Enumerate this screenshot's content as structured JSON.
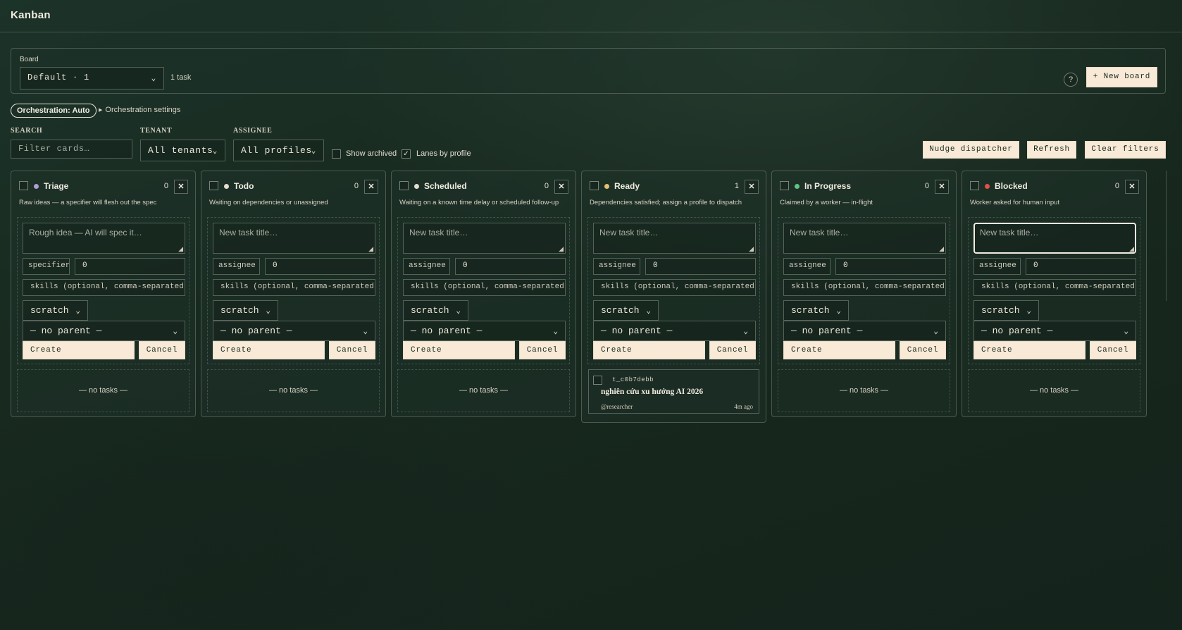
{
  "app": {
    "title": "Kanban"
  },
  "board": {
    "label": "Board",
    "selected": "Default · 1",
    "task_count": "1 task",
    "help": "?",
    "new_board": "+ New board"
  },
  "orchestration": {
    "pill": "Orchestration: Auto",
    "settings": "Orchestration settings"
  },
  "filters": {
    "search_label": "SEARCH",
    "search_placeholder": "Filter cards…",
    "tenant_label": "TENANT",
    "tenant_value": "All tenants",
    "assignee_label": "ASSIGNEE",
    "assignee_value": "All profiles",
    "show_archived": "Show archived",
    "show_archived_checked": false,
    "lanes_by_profile": "Lanes by profile",
    "lanes_by_profile_checked": true
  },
  "toolbar": {
    "nudge": "Nudge dispatcher",
    "refresh": "Refresh",
    "clear": "Clear filters"
  },
  "form_common": {
    "priority": "0",
    "skills_placeholder": "skills (optional, comma-separated)",
    "workspace": "scratch",
    "parent": "— no parent —",
    "create": "Create",
    "cancel": "Cancel",
    "close": "✕",
    "empty": "— no tasks —"
  },
  "columns": [
    {
      "name": "Triage",
      "count": "0",
      "color": "#b49ad8",
      "desc": "Raw ideas — a specifier will flesh out the spec",
      "title_placeholder": "Rough idea — AI will spec it…",
      "role_placeholder": "specifier"
    },
    {
      "name": "Todo",
      "count": "0",
      "color": "#e3ded0",
      "desc": "Waiting on dependencies or unassigned",
      "title_placeholder": "New task title…",
      "role_placeholder": "assignee"
    },
    {
      "name": "Scheduled",
      "count": "0",
      "color": "#e3ded0",
      "desc": "Waiting on a known time delay or scheduled follow-up",
      "title_placeholder": "New task title…",
      "role_placeholder": "assignee"
    },
    {
      "name": "Ready",
      "count": "1",
      "color": "#e6c06e",
      "desc": "Dependencies satisfied; assign a profile to dispatch",
      "title_placeholder": "New task title…",
      "role_placeholder": "assignee"
    },
    {
      "name": "In Progress",
      "count": "0",
      "color": "#5fc48a",
      "desc": "Claimed by a worker — in-flight",
      "title_placeholder": "New task title…",
      "role_placeholder": "assignee"
    },
    {
      "name": "Blocked",
      "count": "0",
      "color": "#e0514a",
      "desc": "Worker asked for human input",
      "title_placeholder": "New task title…",
      "role_placeholder": "assignee"
    }
  ],
  "ready_card": {
    "id": "t_c0b7debb",
    "title": "nghiên cứu xu hướng AI 2026",
    "assignee": "@researcher",
    "time": "4m ago"
  }
}
